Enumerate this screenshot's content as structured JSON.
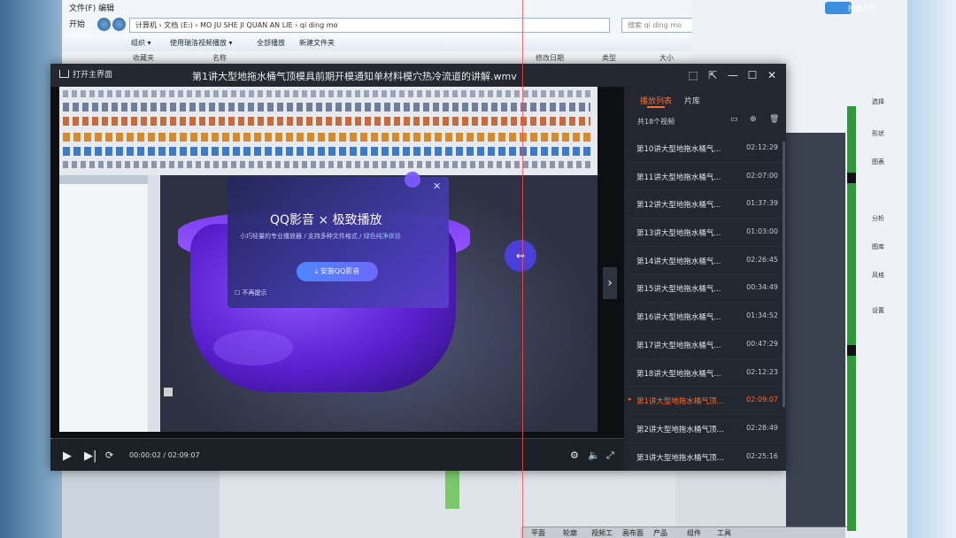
{
  "explorer": {
    "menu": "文件(F)  编辑",
    "start_label": "开始",
    "address": "计算机 › 文档 (E:) › MO JU SHE JI QUAN AN LIE › qi ding mo",
    "search_placeholder": "搜索 qi ding mo",
    "toolbar": [
      "组织 ▾",
      "使用瑞洛视频播放 ▾",
      "全部播放",
      "新建文件夹"
    ],
    "columns": [
      "名称",
      "修改日期",
      "类型",
      "大小"
    ],
    "sidebar_item": "收藏夹"
  },
  "cad_right": {
    "upload_label": "拖拽上传",
    "side_labels": [
      "选择",
      "形状",
      "图表",
      "分析",
      "图库",
      "风格",
      "设置"
    ]
  },
  "status_bar": [
    "平面",
    "轮廓",
    "视频工",
    "画布面",
    "产品",
    "组件",
    "工具"
  ],
  "player": {
    "home_label": "打开主界面",
    "title": "第1讲大型地拖水桶气顶模具前期开模通知单材料模穴热冷流道的讲解.wmv",
    "window_buttons": [
      "⬚",
      "⇱",
      "—",
      "☐",
      "✕"
    ],
    "time_current": "00:00:02",
    "time_total": "02:09:07",
    "time_display": "00:00:02 / 02:09:07",
    "progress": 0.0003
  },
  "promo": {
    "title": "QQ影音 × 极致播放",
    "subtitle_a": "小巧轻量的专业播放器 / 支持多种文件格式 / ",
    "subtitle_b": "绿色纯净体验",
    "button": "⤓ 安装QQ影音",
    "checkbox": "不再提示"
  },
  "playlist": {
    "tab_playlist": "播放列表",
    "tab_library": "片库",
    "count": "共18个视频",
    "items": [
      {
        "name": "第10讲大型地拖水桶气...",
        "dur": "02:12:29"
      },
      {
        "name": "第11讲大型地拖水桶气...",
        "dur": "02:07:00"
      },
      {
        "name": "第12讲大型地拖水桶气...",
        "dur": "01:37:39"
      },
      {
        "name": "第13讲大型地拖水桶气...",
        "dur": "01:03:00"
      },
      {
        "name": "第14讲大型地拖水桶气...",
        "dur": "02:26:45"
      },
      {
        "name": "第15讲大型地拖水桶气...",
        "dur": "00:34:49"
      },
      {
        "name": "第16讲大型地拖水桶气...",
        "dur": "01:34:52"
      },
      {
        "name": "第17讲大型地拖水桶气...",
        "dur": "00:47:29"
      },
      {
        "name": "第18讲大型地拖水桶气...",
        "dur": "02:12:23"
      },
      {
        "name": "第1讲大型地拖水桶气顶...",
        "dur": "02:09:07",
        "active": true
      },
      {
        "name": "第2讲大型地拖水桶气顶...",
        "dur": "02:28:49"
      },
      {
        "name": "第3讲大型地拖水桶气顶...",
        "dur": "02:25:16"
      }
    ]
  },
  "colors": {
    "accent": "#ff6a2b",
    "player_bg": "#1c2027",
    "promo_button": "#5b7bff"
  },
  "icons": [
    "home-icon",
    "play-icon",
    "next-icon",
    "loop-icon",
    "settings-icon",
    "volume-icon",
    "fullscreen-icon",
    "folder-icon",
    "add-icon",
    "trash-icon",
    "close-icon"
  ]
}
